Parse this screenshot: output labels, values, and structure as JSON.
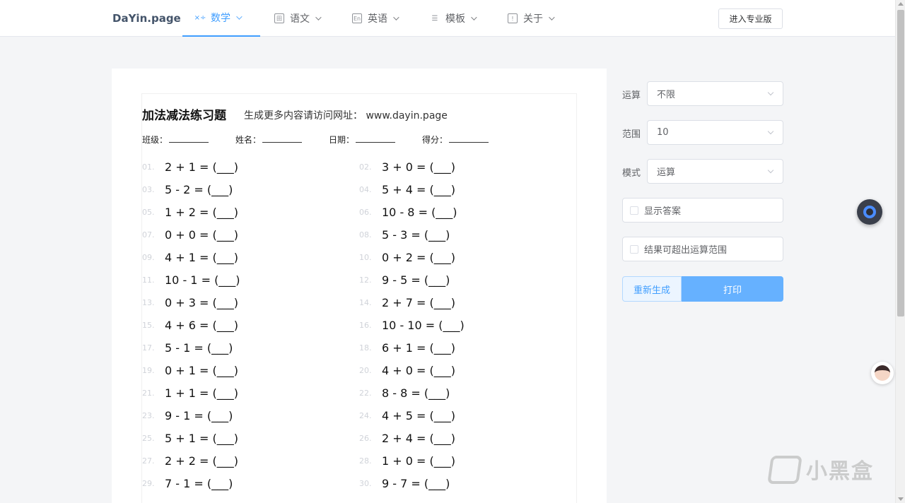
{
  "brand": "DaYin.page",
  "nav": [
    {
      "label": "数学",
      "icon": "math-icon"
    },
    {
      "label": "语文",
      "icon": "chinese-icon"
    },
    {
      "label": "英语",
      "icon": "english-icon"
    },
    {
      "label": "模板",
      "icon": "template-icon"
    },
    {
      "label": "关于",
      "icon": "about-icon"
    }
  ],
  "pro_button": "进入专业版",
  "worksheet": {
    "title": "加法减法练习题",
    "subtitle": "生成更多内容请访问网址：   www.dayin.page",
    "meta": {
      "class": "班级：",
      "name": "姓名：",
      "date": "日期：",
      "score": "得分："
    },
    "problems": [
      {
        "num": "01.",
        "expr": "2 + 1 = (___)"
      },
      {
        "num": "02.",
        "expr": "3 + 0 = (___)"
      },
      {
        "num": "03.",
        "expr": "5 - 2 = (___)"
      },
      {
        "num": "04.",
        "expr": "5 + 4 = (___)"
      },
      {
        "num": "05.",
        "expr": "1 + 2 = (___)"
      },
      {
        "num": "06.",
        "expr": "10 - 8 = (___)"
      },
      {
        "num": "07.",
        "expr": "0 + 0 = (___)"
      },
      {
        "num": "08.",
        "expr": "5 - 3 = (___)"
      },
      {
        "num": "09.",
        "expr": "4 + 1 = (___)"
      },
      {
        "num": "10.",
        "expr": "0 + 2 = (___)"
      },
      {
        "num": "11.",
        "expr": "10 - 1 = (___)"
      },
      {
        "num": "12.",
        "expr": "9 - 5 = (___)"
      },
      {
        "num": "13.",
        "expr": "0 + 3 = (___)"
      },
      {
        "num": "14.",
        "expr": "2 + 7 = (___)"
      },
      {
        "num": "15.",
        "expr": "4 + 6 = (___)"
      },
      {
        "num": "16.",
        "expr": "10 - 10 = (___)"
      },
      {
        "num": "17.",
        "expr": "5 - 1 = (___)"
      },
      {
        "num": "18.",
        "expr": "6 + 1 = (___)"
      },
      {
        "num": "19.",
        "expr": "0 + 1 = (___)"
      },
      {
        "num": "20.",
        "expr": "4 + 0 = (___)"
      },
      {
        "num": "21.",
        "expr": "1 + 1 = (___)"
      },
      {
        "num": "22.",
        "expr": "8 - 8 = (___)"
      },
      {
        "num": "23.",
        "expr": "9 - 1 = (___)"
      },
      {
        "num": "24.",
        "expr": "4 + 5 = (___)"
      },
      {
        "num": "25.",
        "expr": "5 + 1 = (___)"
      },
      {
        "num": "26.",
        "expr": "2 + 4 = (___)"
      },
      {
        "num": "27.",
        "expr": "2 + 2 = (___)"
      },
      {
        "num": "28.",
        "expr": "1 + 0 = (___)"
      },
      {
        "num": "29.",
        "expr": "7 - 1 = (___)"
      },
      {
        "num": "30.",
        "expr": "9 - 7 = (___)"
      }
    ]
  },
  "form": {
    "operation": {
      "label": "运算",
      "value": "不限"
    },
    "range": {
      "label": "范围",
      "value": "10"
    },
    "mode": {
      "label": "模式",
      "value": "运算"
    },
    "show_answer": "显示答案",
    "allow_overflow": "结果可超出运算范围",
    "regenerate": "重新生成",
    "print": "打印"
  },
  "watermark": "小黑盒",
  "colors": {
    "accent": "#409eff",
    "print_button": "#66b1ff"
  }
}
